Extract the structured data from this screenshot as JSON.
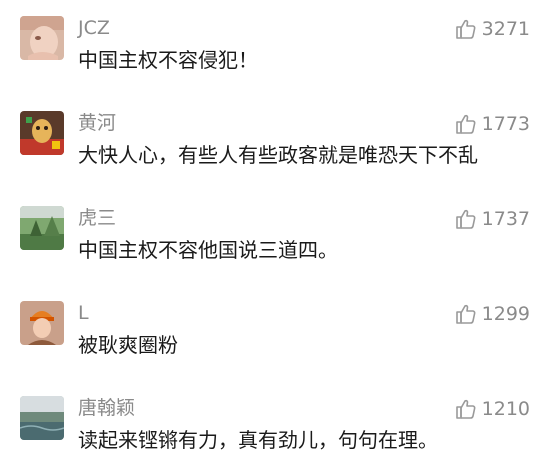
{
  "comments": [
    {
      "username": "JCZ",
      "likes": "3271",
      "text": "中国主权不容侵犯！",
      "avatar": "avatar-photo-light-skin"
    },
    {
      "username": "黄河",
      "likes": "1773",
      "text": "大快人心，有些人有些政客就是唯恐天下不乱",
      "avatar": "avatar-photo-colorful-figure"
    },
    {
      "username": "虎三",
      "likes": "1737",
      "text": "中国主权不容他国说三道四。",
      "avatar": "avatar-photo-green-landscape"
    },
    {
      "username": "L",
      "likes": "1299",
      "text": "被耿爽圈粉",
      "avatar": "avatar-photo-person-orange-hat"
    },
    {
      "username": "唐翰颖",
      "likes": "1210",
      "text": "读起来铿锵有力，真有劲儿，句句在理。",
      "avatar": "avatar-photo-water-landscape"
    }
  ],
  "icons": {
    "like": "thumbs-up-icon"
  },
  "colors": {
    "meta_text": "#8a8a8a",
    "body_text": "#1a1a1a",
    "background": "#ffffff"
  }
}
